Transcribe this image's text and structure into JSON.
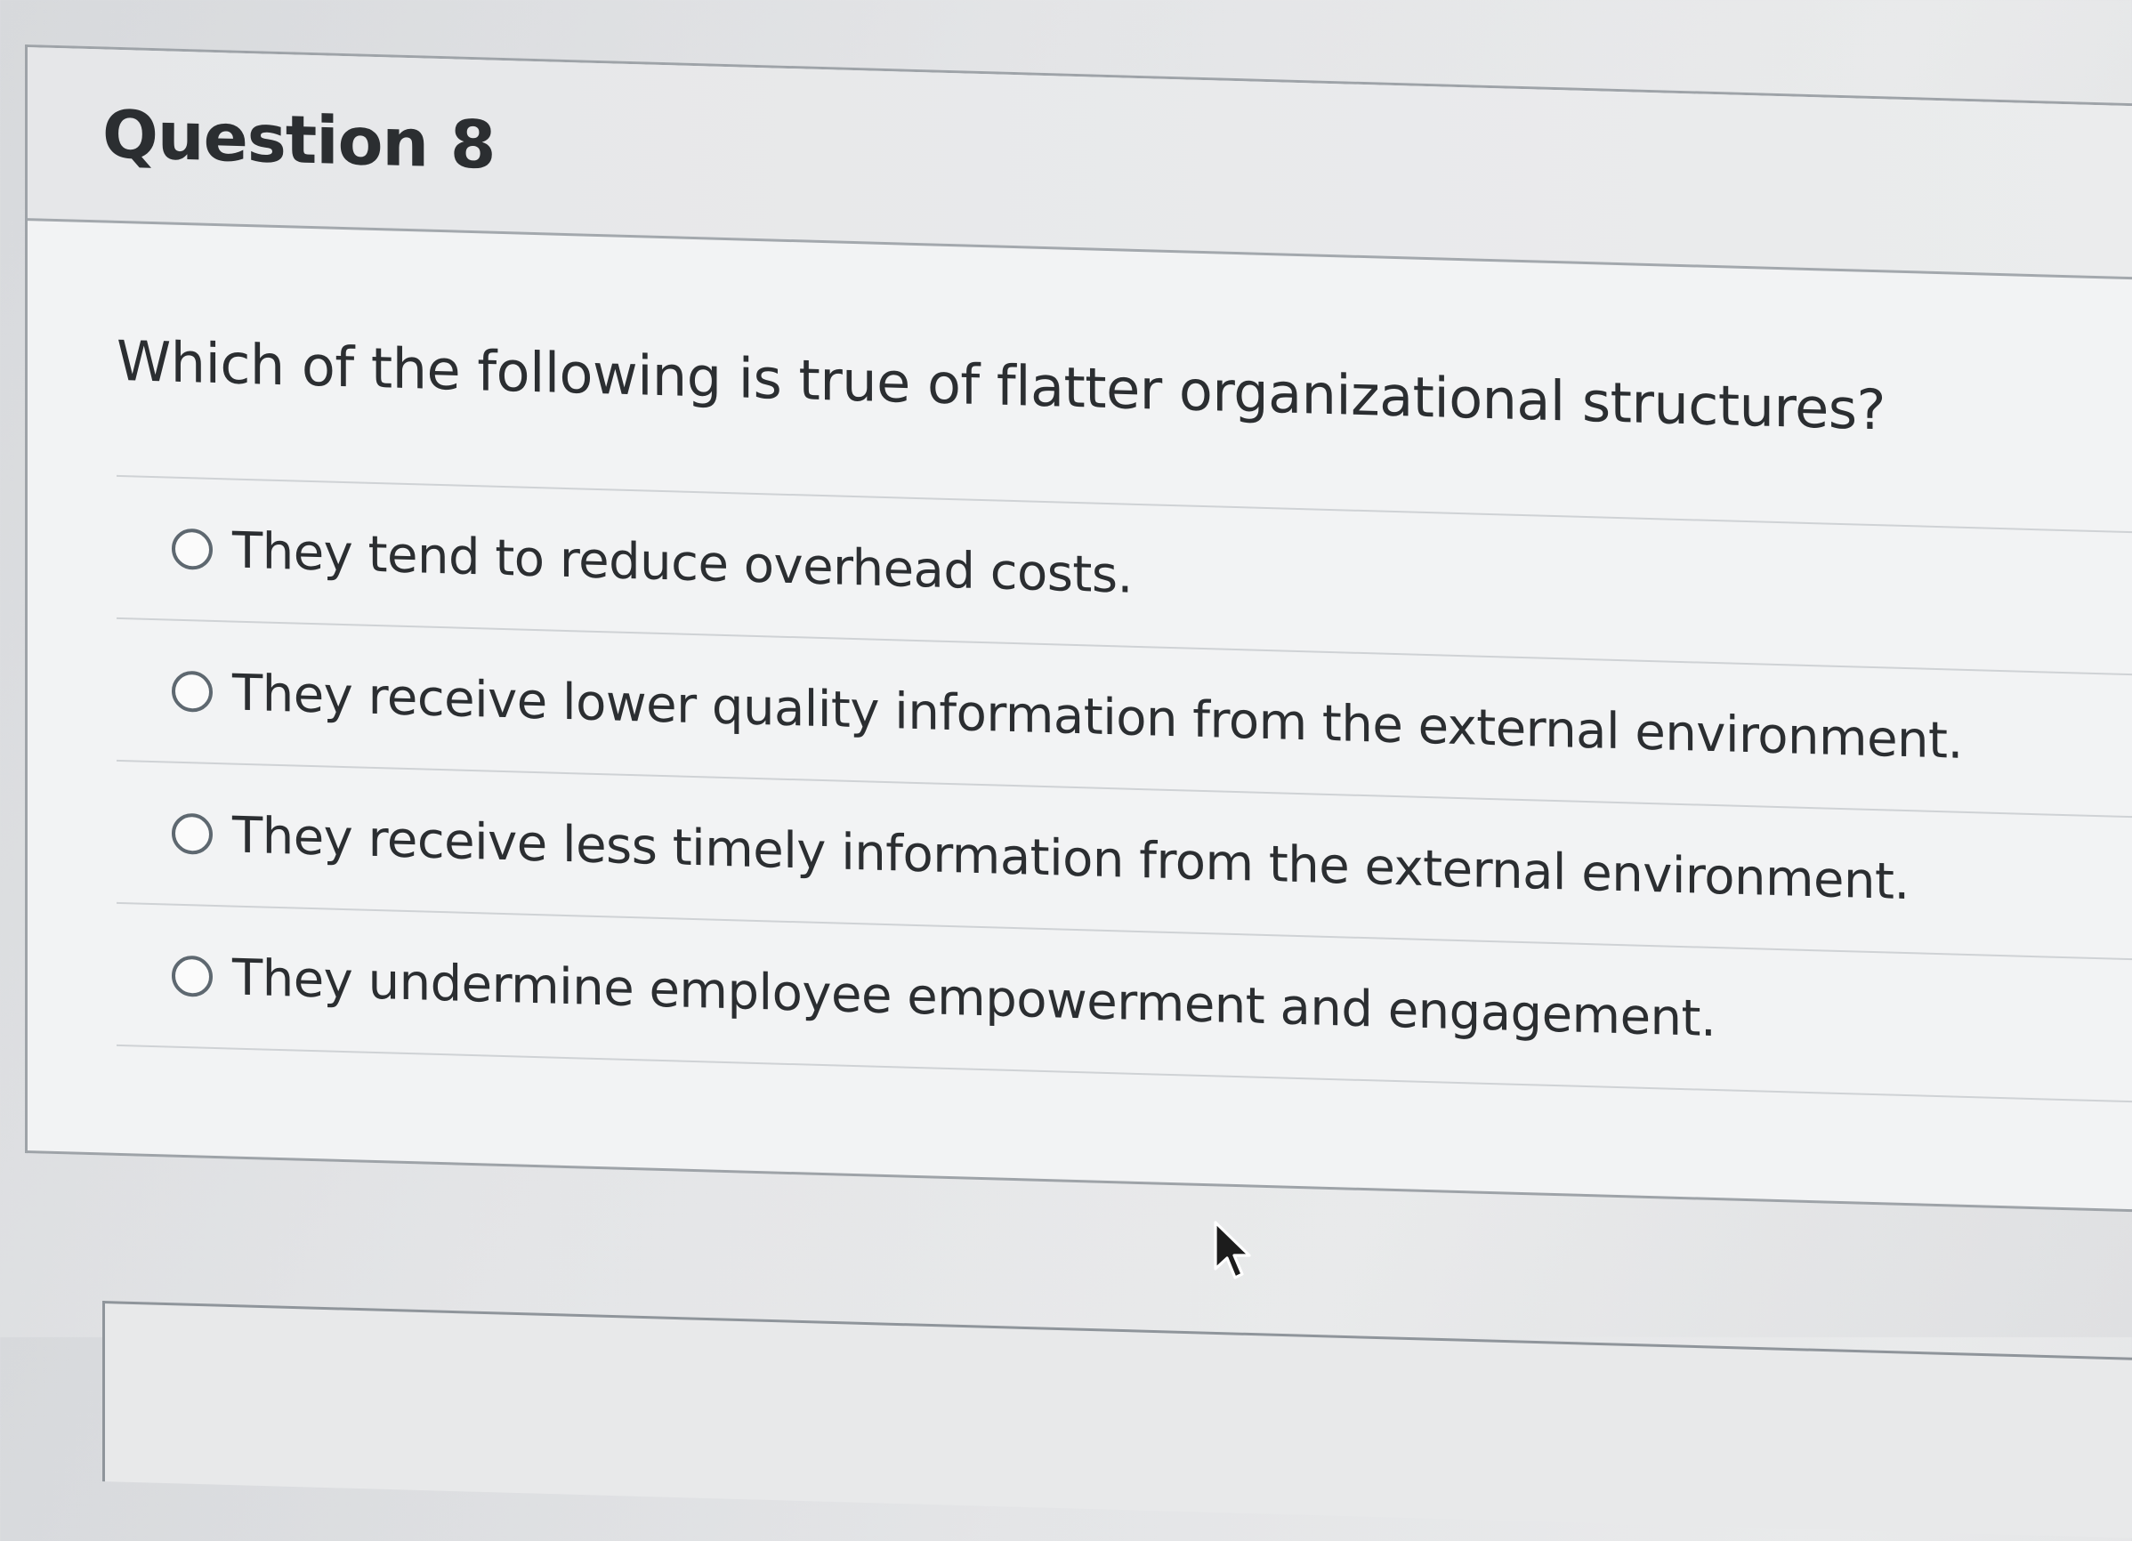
{
  "question": {
    "header": "Question 8",
    "text": "Which of the following is true of flatter organizational structures?",
    "answers": [
      {
        "label": "They tend to reduce overhead costs."
      },
      {
        "label": "They receive lower quality information from the external environment."
      },
      {
        "label": "They receive less timely information from the external environment."
      },
      {
        "label": "They undermine employee empowerment and engagement."
      }
    ]
  },
  "icons": {
    "radio": "radio-unselected-icon",
    "cursor": "mouse-pointer-icon"
  },
  "colors": {
    "card_background": "#f2f3f4",
    "header_background": "#e6e7e9",
    "border": "#9ea3a8",
    "text": "#2b2e31",
    "radio_border": "#5e6870"
  }
}
